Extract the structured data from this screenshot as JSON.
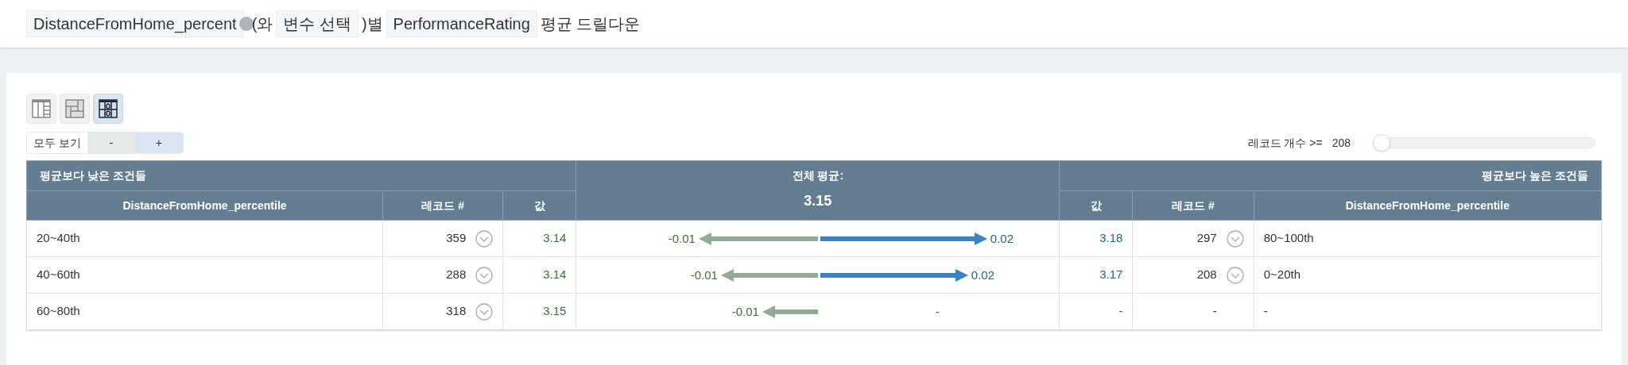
{
  "header": {
    "field_chip": "DistanceFromHome_percent",
    "connector": "(와",
    "variable_chip": "변수 선택",
    "suffix_1": ")별",
    "target_chip": "PerformanceRating",
    "suffix_2": "평균 드릴다운"
  },
  "view_buttons": [
    {
      "kind": "table",
      "selected": false
    },
    {
      "kind": "panes",
      "selected": false
    },
    {
      "kind": "drilldown",
      "selected": true
    }
  ],
  "zoom": {
    "show_all": "모두 보기",
    "minus": "-",
    "plus": "+"
  },
  "filter": {
    "label": "레코드 개수 >=",
    "value": "208",
    "level": 0
  },
  "table": {
    "lower_title": "평균보다 낮은 조건들",
    "center_title": "전체 평균:",
    "center_value": "3.15",
    "higher_title": "평균보다 높은 조건들",
    "left_columns": [
      "DistanceFromHome_percentile",
      "레코드 #",
      "값"
    ],
    "right_columns": [
      "값",
      "레코드 #",
      "DistanceFromHome_percentile"
    ],
    "rows": [
      {
        "low": {
          "condition": "20~40th",
          "records": "359",
          "expandable": true,
          "value": "3.14",
          "delta": "-0.01",
          "arrow": true
        },
        "high": {
          "condition": "80~100th",
          "records": "297",
          "expandable": true,
          "value": "3.18",
          "delta": "0.02",
          "arrow": true
        }
      },
      {
        "low": {
          "condition": "40~60th",
          "records": "288",
          "expandable": true,
          "value": "3.14",
          "delta": "-0.01",
          "arrow": true
        },
        "high": {
          "condition": "0~20th",
          "records": "208",
          "expandable": true,
          "value": "3.17",
          "delta": "0.02",
          "arrow": true
        }
      },
      {
        "low": {
          "condition": "60~80th",
          "records": "318",
          "expandable": true,
          "value": "3.15",
          "delta": "-0.01",
          "arrow": true
        },
        "high": {
          "condition": "-",
          "records": "-",
          "expandable": false,
          "value": "-",
          "delta": "-",
          "arrow": false
        }
      }
    ]
  }
}
